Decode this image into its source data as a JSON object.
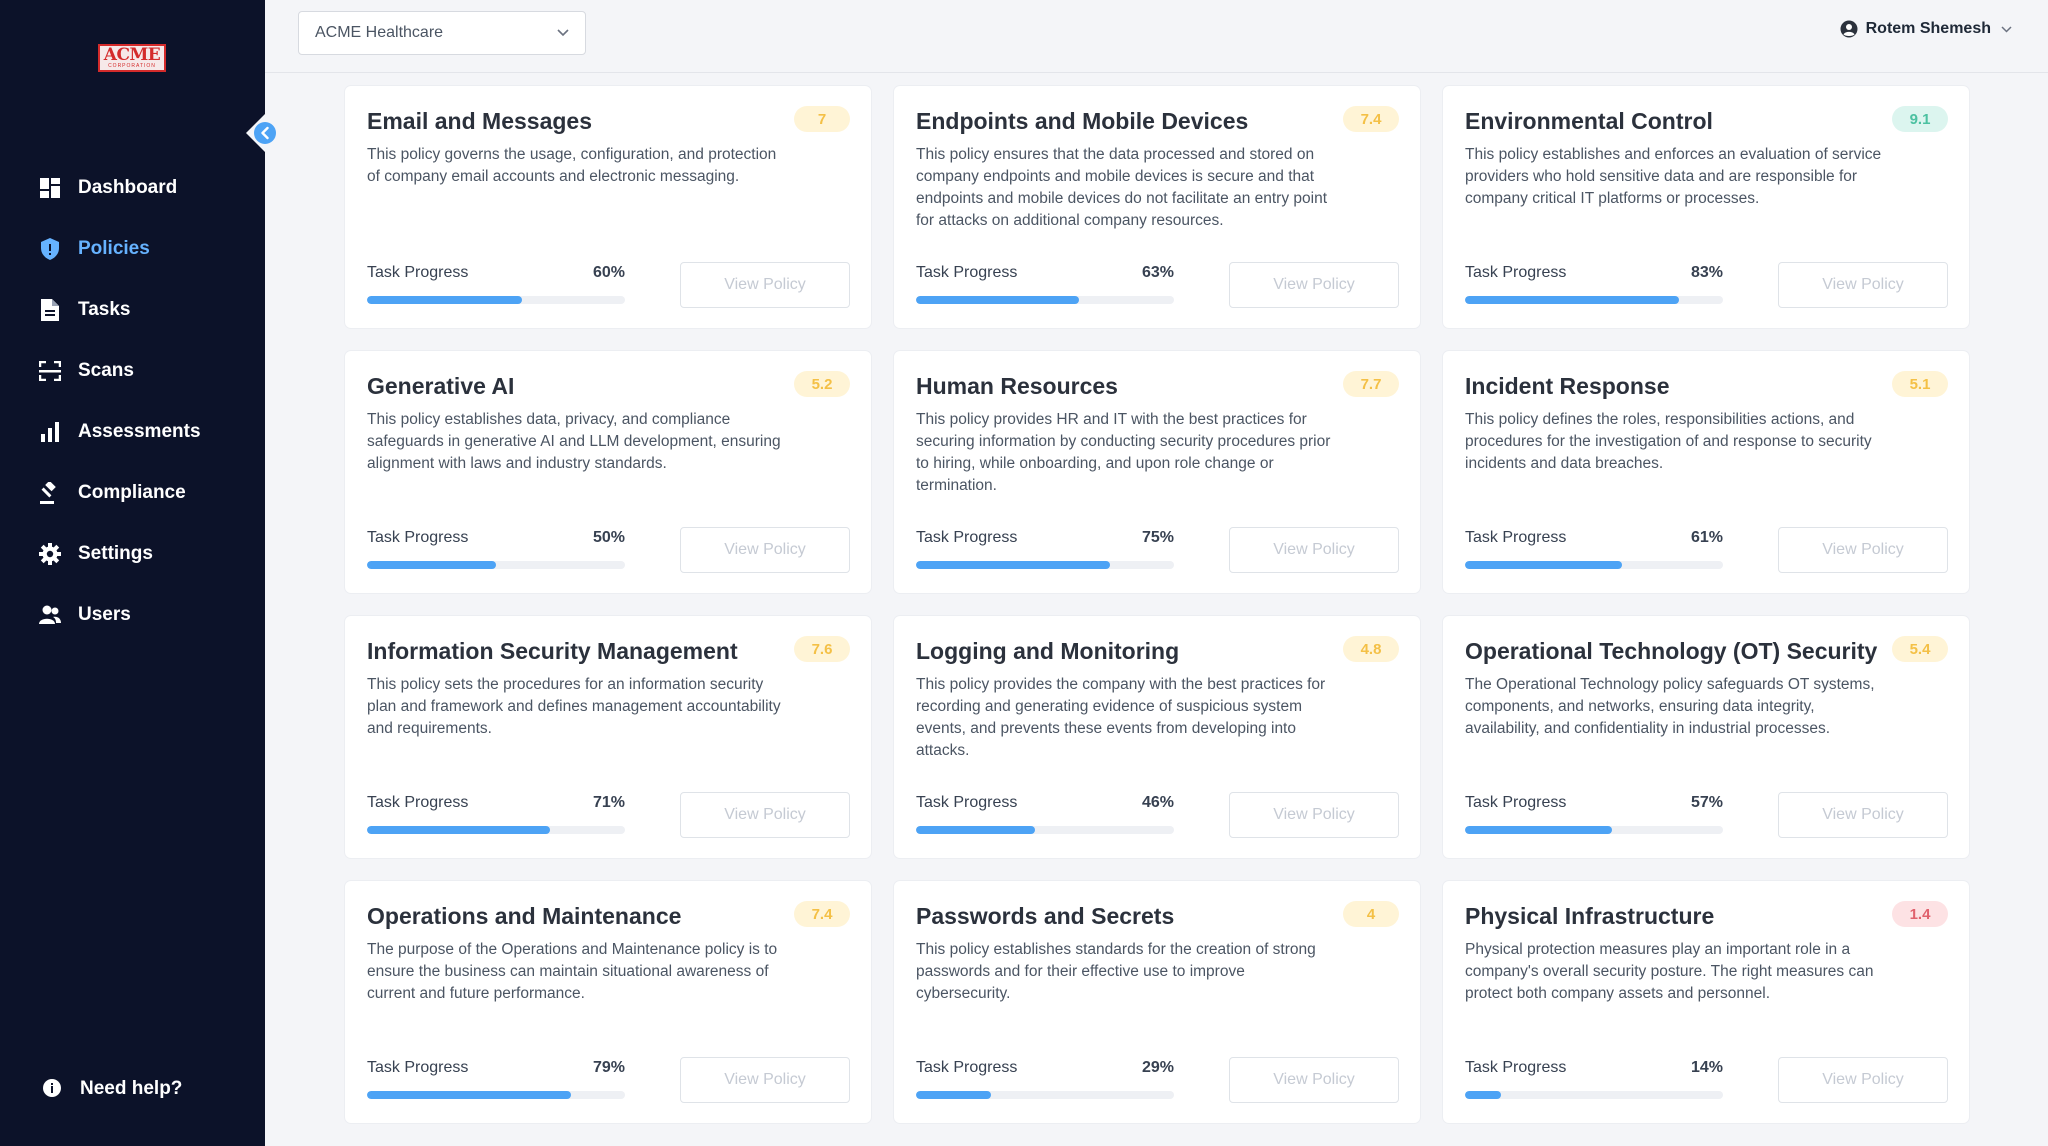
{
  "brand": {
    "logo_text": "ACME",
    "logo_subtext": "CORPORATION",
    "accent": "#66b2ff",
    "sidebar_bg": "#0c1229"
  },
  "sidebar": {
    "items": [
      {
        "label": "Dashboard",
        "icon": "dashboard-icon",
        "active": false
      },
      {
        "label": "Policies",
        "icon": "shield-icon",
        "active": true
      },
      {
        "label": "Tasks",
        "icon": "document-icon",
        "active": false
      },
      {
        "label": "Scans",
        "icon": "scan-icon",
        "active": false
      },
      {
        "label": "Assessments",
        "icon": "bar-chart-icon",
        "active": false
      },
      {
        "label": "Compliance",
        "icon": "gavel-icon",
        "active": false
      },
      {
        "label": "Settings",
        "icon": "gear-icon",
        "active": false
      },
      {
        "label": "Users",
        "icon": "users-icon",
        "active": false
      }
    ],
    "help_label": "Need help?"
  },
  "header": {
    "org_select_value": "ACME Healthcare",
    "user_name": "Rotem Shemesh"
  },
  "policies": [
    {
      "title": "Email and Messages",
      "score": "7",
      "score_color": "yellow",
      "description": "This policy governs the usage, configuration, and protection of company email accounts and electronic messaging.",
      "progress_label": "Task Progress",
      "progress": 60,
      "progress_text": "60%",
      "button": "View Policy"
    },
    {
      "title": "Endpoints and Mobile Devices",
      "score": "7.4",
      "score_color": "yellow",
      "description": "This policy ensures that the data processed and stored on company endpoints and mobile devices is secure and that endpoints and mobile devices do not facilitate an entry point for attacks on additional company resources.",
      "progress_label": "Task Progress",
      "progress": 63,
      "progress_text": "63%",
      "button": "View Policy"
    },
    {
      "title": "Environmental Control",
      "score": "9.1",
      "score_color": "green",
      "description": "This policy establishes and enforces an evaluation of service providers who hold sensitive data and are responsible for company critical IT platforms or processes.",
      "progress_label": "Task Progress",
      "progress": 83,
      "progress_text": "83%",
      "button": "View Policy"
    },
    {
      "title": "Generative AI",
      "score": "5.2",
      "score_color": "yellow",
      "description": "This policy establishes data, privacy, and compliance safeguards in generative AI and LLM development, ensuring alignment with laws and industry standards.",
      "progress_label": "Task Progress",
      "progress": 50,
      "progress_text": "50%",
      "button": "View Policy"
    },
    {
      "title": "Human Resources",
      "score": "7.7",
      "score_color": "yellow",
      "description": "This policy provides HR and IT with the best practices for securing information by conducting security procedures prior to hiring, while onboarding, and upon role change or termination.",
      "progress_label": "Task Progress",
      "progress": 75,
      "progress_text": "75%",
      "button": "View Policy"
    },
    {
      "title": "Incident Response",
      "score": "5.1",
      "score_color": "yellow",
      "description": "This policy defines the roles, responsibilities actions, and procedures for the investigation of and response to security incidents and data breaches.",
      "progress_label": "Task Progress",
      "progress": 61,
      "progress_text": "61%",
      "button": "View Policy"
    },
    {
      "title": "Information Security Management",
      "score": "7.6",
      "score_color": "yellow",
      "description": "This policy sets the procedures for an information security plan and framework and defines management accountability and requirements.",
      "progress_label": "Task Progress",
      "progress": 71,
      "progress_text": "71%",
      "button": "View Policy"
    },
    {
      "title": "Logging and Monitoring",
      "score": "4.8",
      "score_color": "yellow",
      "description": "This policy provides the company with the best practices for recording and generating evidence of suspicious system events, and prevents these events from developing into attacks.",
      "progress_label": "Task Progress",
      "progress": 46,
      "progress_text": "46%",
      "button": "View Policy"
    },
    {
      "title": "Operational Technology (OT) Security",
      "score": "5.4",
      "score_color": "yellow",
      "description": "The Operational Technology policy safeguards OT systems, components, and networks, ensuring data integrity, availability, and confidentiality in industrial processes.",
      "progress_label": "Task Progress",
      "progress": 57,
      "progress_text": "57%",
      "button": "View Policy"
    },
    {
      "title": "Operations and Maintenance",
      "score": "7.4",
      "score_color": "yellow",
      "description": "The purpose of the Operations and Maintenance policy is to ensure the business can maintain situational awareness of current and future performance.",
      "progress_label": "Task Progress",
      "progress": 79,
      "progress_text": "79%",
      "button": "View Policy"
    },
    {
      "title": "Passwords and Secrets",
      "score": "4",
      "score_color": "yellow",
      "description": "This policy establishes standards for the creation of strong passwords and for their effective use to improve cybersecurity.",
      "progress_label": "Task Progress",
      "progress": 29,
      "progress_text": "29%",
      "button": "View Policy"
    },
    {
      "title": "Physical Infrastructure",
      "score": "1.4",
      "score_color": "red",
      "description": "Physical protection measures play an important role in a company's overall security posture. The right measures can protect both company assets and personnel.",
      "progress_label": "Task Progress",
      "progress": 14,
      "progress_text": "14%",
      "button": "View Policy"
    }
  ]
}
